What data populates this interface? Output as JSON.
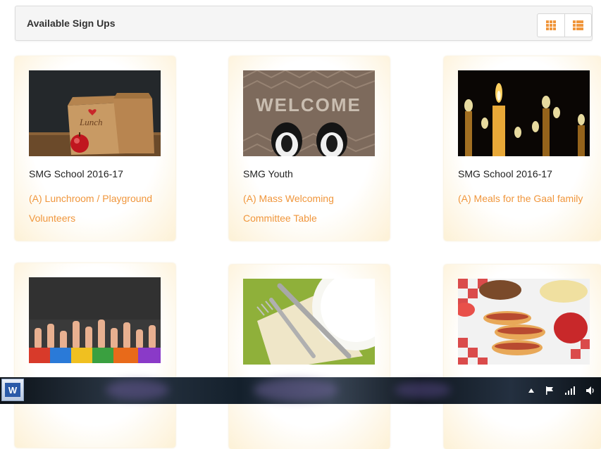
{
  "header": {
    "title": "Available Sign Ups"
  },
  "view_toggle": {
    "grid_icon": "grid-icon",
    "list_icon": "list-icon",
    "accent": "#f0963c"
  },
  "cards": [
    {
      "org": "SMG School 2016-17",
      "title": "(A) Lunchroom / Playground Volunteers",
      "image": "lunch-bags-image"
    },
    {
      "org": "SMG Youth",
      "title": "(A) Mass Welcoming Committee Table",
      "image": "welcome-mat-image"
    },
    {
      "org": "SMG School 2016-17",
      "title": "(A) Meals for the Gaal family",
      "image": "candles-image"
    },
    {
      "org": "",
      "title": "",
      "image": "raised-hands-image"
    },
    {
      "org": "",
      "title": "",
      "image": "place-setting-image"
    },
    {
      "org": "",
      "title": "",
      "image": "hot-dogs-image"
    }
  ],
  "taskbar": {
    "app_icon": "word-icon",
    "tray_icons": [
      "up-arrow-icon",
      "flag-icon",
      "signal-icon",
      "volume-icon"
    ]
  }
}
